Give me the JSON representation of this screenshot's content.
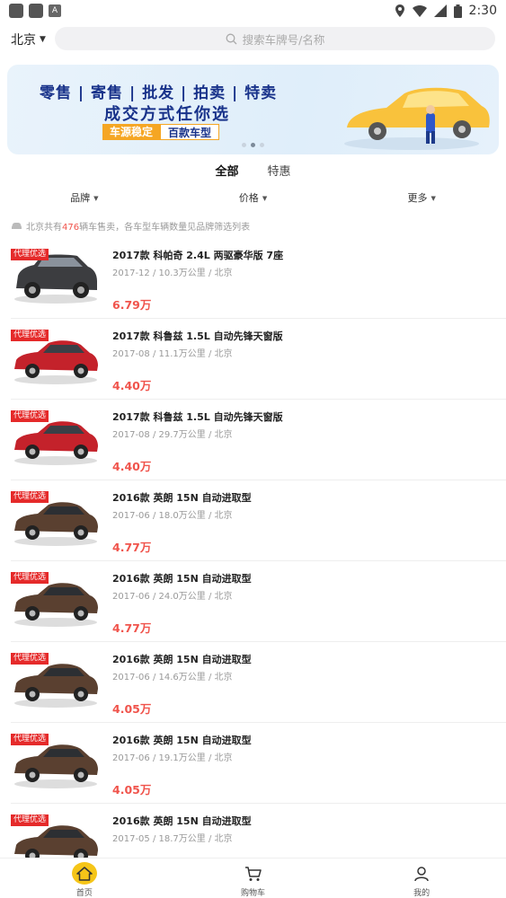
{
  "status": {
    "time": "2:30",
    "app_icon_letter": "A"
  },
  "header": {
    "city": "北京",
    "search_placeholder": "搜索车牌号/名称"
  },
  "banner": {
    "line1": "零售 | 寄售 | 批发 | 拍卖 | 特卖",
    "line2": "成交方式任你选",
    "tag1": "车源稳定",
    "tag2": "百款车型",
    "active_dot": 1
  },
  "tabs": [
    {
      "label": "全部",
      "active": true
    },
    {
      "label": "特惠",
      "active": false
    }
  ],
  "filters": [
    {
      "label": "品牌"
    },
    {
      "label": "价格"
    },
    {
      "label": "更多"
    }
  ],
  "summary": {
    "prefix": "北京共有",
    "count": "476",
    "suffix": "辆车售卖，各车型车辆数量见品牌筛选列表"
  },
  "listings": [
    {
      "badge": "代理优选",
      "title": "2017款 科帕奇 2.4L 两驱豪华版 7座",
      "meta": "2017-12 / 10.3万公里 / 北京",
      "price": "6.79万",
      "car": "suv-dark"
    },
    {
      "badge": "代理优选",
      "title": "2017款 科鲁兹 1.5L 自动先锋天窗版",
      "meta": "2017-08 / 11.1万公里 / 北京",
      "price": "4.40万",
      "car": "sedan-red"
    },
    {
      "badge": "代理优选",
      "title": "2017款 科鲁兹 1.5L 自动先锋天窗版",
      "meta": "2017-08 / 29.7万公里 / 北京",
      "price": "4.40万",
      "car": "sedan-red"
    },
    {
      "badge": "代理优选",
      "title": "2016款 英朗 15N 自动进取型",
      "meta": "2017-06 / 18.0万公里 / 北京",
      "price": "4.77万",
      "car": "sedan-brown"
    },
    {
      "badge": "代理优选",
      "title": "2016款 英朗 15N 自动进取型",
      "meta": "2017-06 / 24.0万公里 / 北京",
      "price": "4.77万",
      "car": "sedan-brown"
    },
    {
      "badge": "代理优选",
      "title": "2016款 英朗 15N 自动进取型",
      "meta": "2017-06 / 14.6万公里 / 北京",
      "price": "4.05万",
      "car": "sedan-brown"
    },
    {
      "badge": "代理优选",
      "title": "2016款 英朗 15N 自动进取型",
      "meta": "2017-06 / 19.1万公里 / 北京",
      "price": "4.05万",
      "car": "sedan-brown"
    },
    {
      "badge": "代理优选",
      "title": "2016款 英朗 15N 自动进取型",
      "meta": "2017-05 / 18.7万公里 / 北京",
      "price": "",
      "car": "sedan-brown"
    }
  ],
  "bottom_nav": [
    {
      "label": "首页",
      "icon": "home-icon",
      "active": true
    },
    {
      "label": "购物车",
      "icon": "cart-icon",
      "active": false
    },
    {
      "label": "我的",
      "icon": "user-icon",
      "active": false
    }
  ],
  "colors": {
    "accent": "#f5c518",
    "price": "#f0544c",
    "badge": "#e52a2a",
    "banner_text": "#18328a"
  }
}
